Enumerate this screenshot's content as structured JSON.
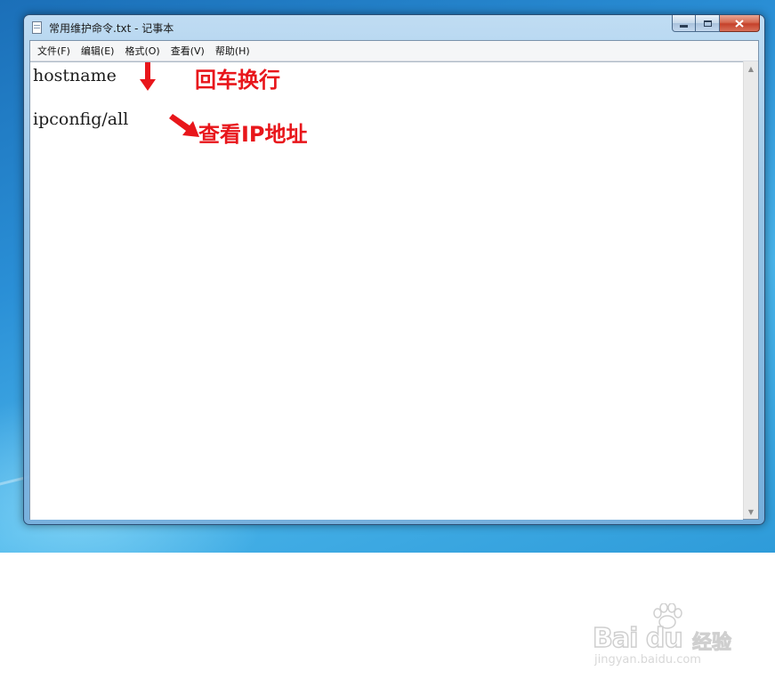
{
  "window": {
    "title": "常用维护命令.txt - 记事本",
    "icon": "notepad-icon"
  },
  "menu": {
    "items": [
      {
        "label": "文件(F)"
      },
      {
        "label": "编辑(E)"
      },
      {
        "label": "格式(O)"
      },
      {
        "label": "查看(V)"
      },
      {
        "label": "帮助(H)"
      }
    ]
  },
  "editor": {
    "lines": [
      "hostname",
      "ipconfig/all"
    ]
  },
  "annotations": {
    "enter_newline": "回车换行",
    "view_ip": "查看IP地址",
    "color": "#e8161b"
  },
  "watermark": {
    "logo": "Bai du",
    "brand": "经验",
    "url": "jingyan.baidu.com"
  }
}
